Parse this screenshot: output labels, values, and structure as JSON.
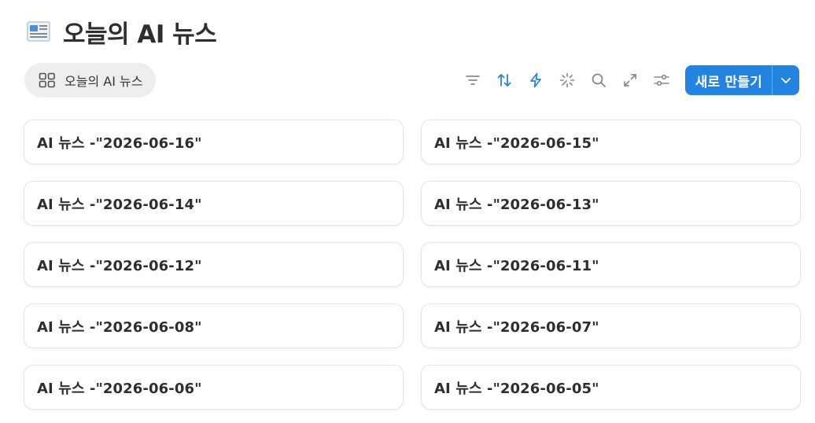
{
  "page": {
    "title": "오늘의 AI 뉴스",
    "icon": "newspaper-icon"
  },
  "view_tab": {
    "label": "오늘의 AI 뉴스",
    "icon": "gallery-grid-icon"
  },
  "toolbar": {
    "icons": [
      "filter-icon",
      "sort-icon",
      "automation-icon",
      "ai-sparkle-icon",
      "search-icon",
      "expand-icon",
      "settings-sliders-icon"
    ],
    "accent_color": "#2383e2",
    "new_button_label": "새로 만들기"
  },
  "cards": [
    {
      "title": "AI 뉴스 -\"2026-06-16\""
    },
    {
      "title": "AI 뉴스 -\"2026-06-15\""
    },
    {
      "title": "AI 뉴스 -\"2026-06-14\""
    },
    {
      "title": "AI 뉴스 -\"2026-06-13\""
    },
    {
      "title": "AI 뉴스 -\"2026-06-12\""
    },
    {
      "title": "AI 뉴스 -\"2026-06-11\""
    },
    {
      "title": "AI 뉴스 -\"2026-06-08\""
    },
    {
      "title": "AI 뉴스 -\"2026-06-07\""
    },
    {
      "title": "AI 뉴스 -\"2026-06-06\""
    },
    {
      "title": "AI 뉴스 -\"2026-06-05\""
    }
  ]
}
